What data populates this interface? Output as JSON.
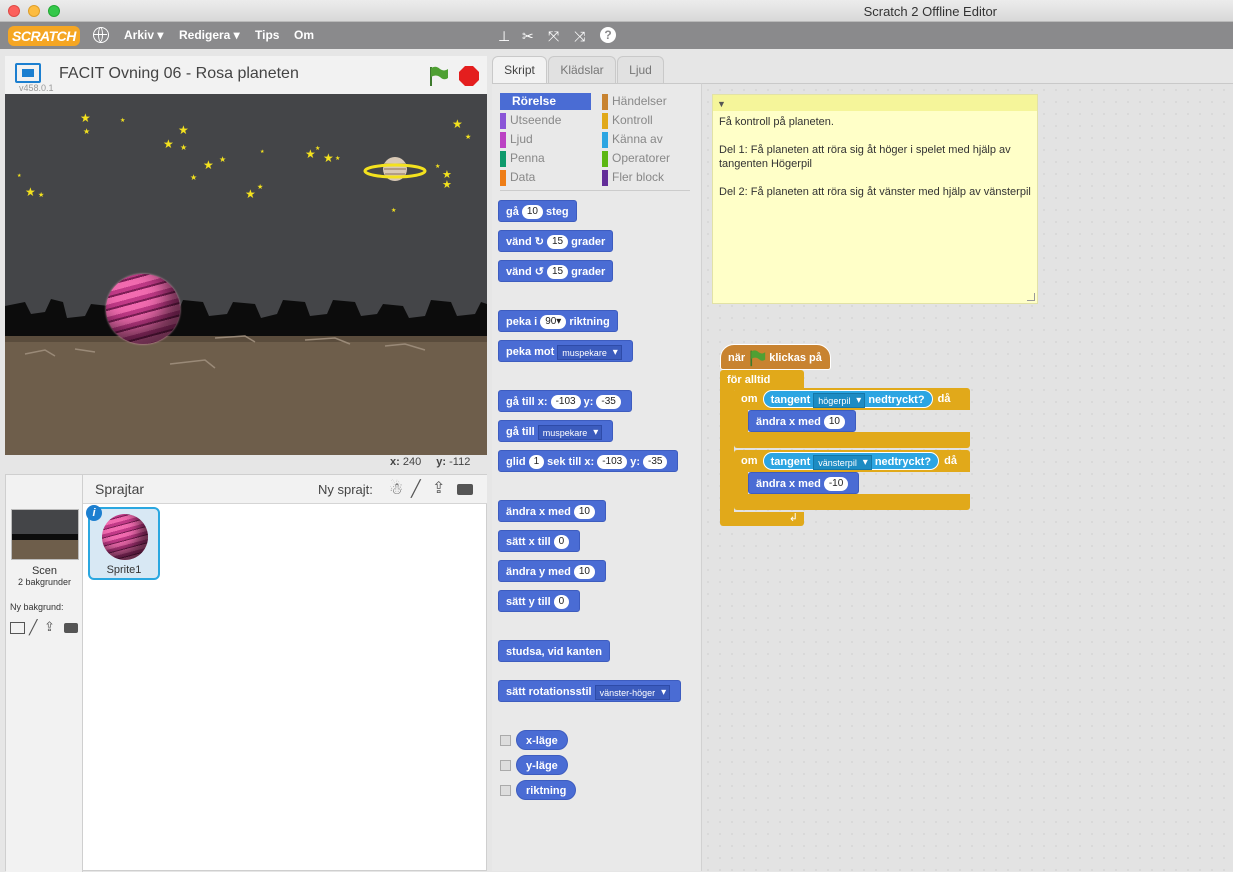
{
  "window": {
    "title": "Scratch 2 Offline Editor"
  },
  "menubar": {
    "logo": "SCRATCH",
    "items": [
      "Arkiv ▾",
      "Redigera ▾",
      "Tips",
      "Om"
    ]
  },
  "stage": {
    "project_title": "FACIT Ovning 06 - Rosa planeten",
    "version": "v458.0.1",
    "x_label": "x:",
    "x_value": "240",
    "y_label": "y:",
    "y_value": "-112"
  },
  "sprites": {
    "header": "Sprajtar",
    "new_sprite_label": "Ny sprajt:",
    "scene_label": "Scen",
    "scene_backdrops": "2 bakgrunder",
    "new_backdrop_label": "Ny bakgrund:",
    "items": [
      {
        "name": "Sprite1"
      }
    ]
  },
  "tabs": [
    "Skript",
    "Klädslar",
    "Ljud"
  ],
  "categories": {
    "left": [
      {
        "label": "Rörelse",
        "color": "#4a6cd4"
      },
      {
        "label": "Utseende",
        "color": "#8a55d7"
      },
      {
        "label": "Ljud",
        "color": "#bb42c3"
      },
      {
        "label": "Penna",
        "color": "#0e9a6c"
      },
      {
        "label": "Data",
        "color": "#ee7d16"
      }
    ],
    "right": [
      {
        "label": "Händelser",
        "color": "#c88330"
      },
      {
        "label": "Kontroll",
        "color": "#e1a91a"
      },
      {
        "label": "Känna av",
        "color": "#2ca5e2"
      },
      {
        "label": "Operatorer",
        "color": "#5cb712"
      },
      {
        "label": "Fler block",
        "color": "#632d99"
      }
    ]
  },
  "blocks": {
    "move": {
      "pre": "gå",
      "val": "10",
      "post": "steg"
    },
    "turn_right": {
      "pre": "vänd",
      "val": "15",
      "post": "grader"
    },
    "turn_left": {
      "pre": "vänd",
      "val": "15",
      "post": "grader"
    },
    "point_dir": {
      "pre": "peka i",
      "val": "90▾",
      "post": "riktning"
    },
    "point_towards": {
      "pre": "peka mot",
      "dd": "muspekare"
    },
    "goto_xy": {
      "pre": "gå till x:",
      "x": "-103",
      "mid": "y:",
      "y": "-35"
    },
    "goto": {
      "pre": "gå till",
      "dd": "muspekare"
    },
    "glide": {
      "pre": "glid",
      "secs": "1",
      "mid1": "sek till x:",
      "x": "-103",
      "mid2": "y:",
      "y": "-35"
    },
    "change_x": {
      "pre": "ändra x med",
      "val": "10"
    },
    "set_x": {
      "pre": "sätt x till",
      "val": "0"
    },
    "change_y": {
      "pre": "ändra y med",
      "val": "10"
    },
    "set_y": {
      "pre": "sätt y till",
      "val": "0"
    },
    "bounce": {
      "label": "studsa, vid kanten"
    },
    "rotation_style": {
      "pre": "sätt rotationsstil",
      "dd": "vänster-höger"
    },
    "reporters": [
      "x-läge",
      "y-läge",
      "riktning"
    ]
  },
  "note": {
    "lines": [
      "Få kontroll på planeten.",
      "Del 1: Få planeten att röra sig åt höger i spelet med hjälp av tangenten Högerpil",
      "Del 2: Få planeten att röra sig åt vänster med hjälp av vänsterpil"
    ]
  },
  "script": {
    "hat_pre": "när",
    "hat_post": "klickas på",
    "forever": "för alltid",
    "if1": {
      "om": "om",
      "sense_pre": "tangent",
      "key": "högerpil",
      "sense_post": "nedtryckt?",
      "then": "då",
      "action": "ändra x med",
      "val": "10"
    },
    "if2": {
      "om": "om",
      "sense_pre": "tangent",
      "key": "vänsterpil",
      "sense_post": "nedtryckt?",
      "then": "då",
      "action": "ändra x med",
      "val": "-10"
    }
  }
}
